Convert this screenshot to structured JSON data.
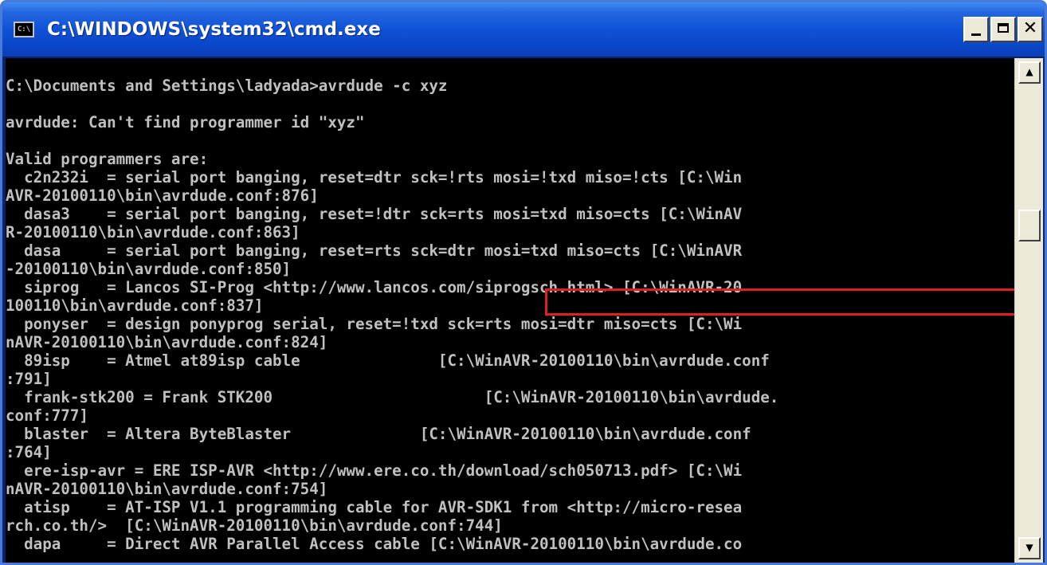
{
  "window": {
    "title": "C:\\WINDOWS\\system32\\cmd.exe",
    "app_icon_text": "C:\\"
  },
  "controls": {
    "close_label": "✕"
  },
  "scrollbar": {
    "up_glyph": "▲",
    "down_glyph": "▼"
  },
  "console": {
    "lines": [
      "",
      "C:\\Documents and Settings\\ladyada>avrdude -c xyz",
      "",
      "avrdude: Can't find programmer id \"xyz\"",
      "",
      "Valid programmers are:",
      "  c2n232i  = serial port banging, reset=dtr sck=!rts mosi=!txd miso=!cts [C:\\Win",
      "AVR-20100110\\bin\\avrdude.conf:876]",
      "  dasa3    = serial port banging, reset=!dtr sck=rts mosi=txd miso=cts [C:\\WinAV",
      "R-20100110\\bin\\avrdude.conf:863]",
      "  dasa     = serial port banging, reset=rts sck=dtr mosi=txd miso=cts [C:\\WinAVR",
      "-20100110\\bin\\avrdude.conf:850]",
      "  siprog   = Lancos SI-Prog <http://www.lancos.com/siprogsch.html> [C:\\WinAVR-20",
      "100110\\bin\\avrdude.conf:837]",
      "  ponyser  = design ponyprog serial, reset=!txd sck=rts mosi=dtr miso=cts [C:\\Wi",
      "nAVR-20100110\\bin\\avrdude.conf:824]",
      "  89isp    = Atmel at89isp cable               [C:\\WinAVR-20100110\\bin\\avrdude.conf",
      ":791]",
      "  frank-stk200 = Frank STK200                       [C:\\WinAVR-20100110\\bin\\avrdude.",
      "conf:777]",
      "  blaster  = Altera ByteBlaster              [C:\\WinAVR-20100110\\bin\\avrdude.conf",
      ":764]",
      "  ere-isp-avr = ERE ISP-AVR <http://www.ere.co.th/download/sch050713.pdf> [C:\\Wi",
      "nAVR-20100110\\bin\\avrdude.conf:754]",
      "  atisp    = AT-ISP V1.1 programming cable for AVR-SDK1 from <http://micro-resea",
      "rch.co.th/>  [C:\\WinAVR-20100110\\bin\\avrdude.conf:744]",
      "  dapa     = Direct AVR Parallel Access cable [C:\\WinAVR-20100110\\bin\\avrdude.co"
    ]
  }
}
